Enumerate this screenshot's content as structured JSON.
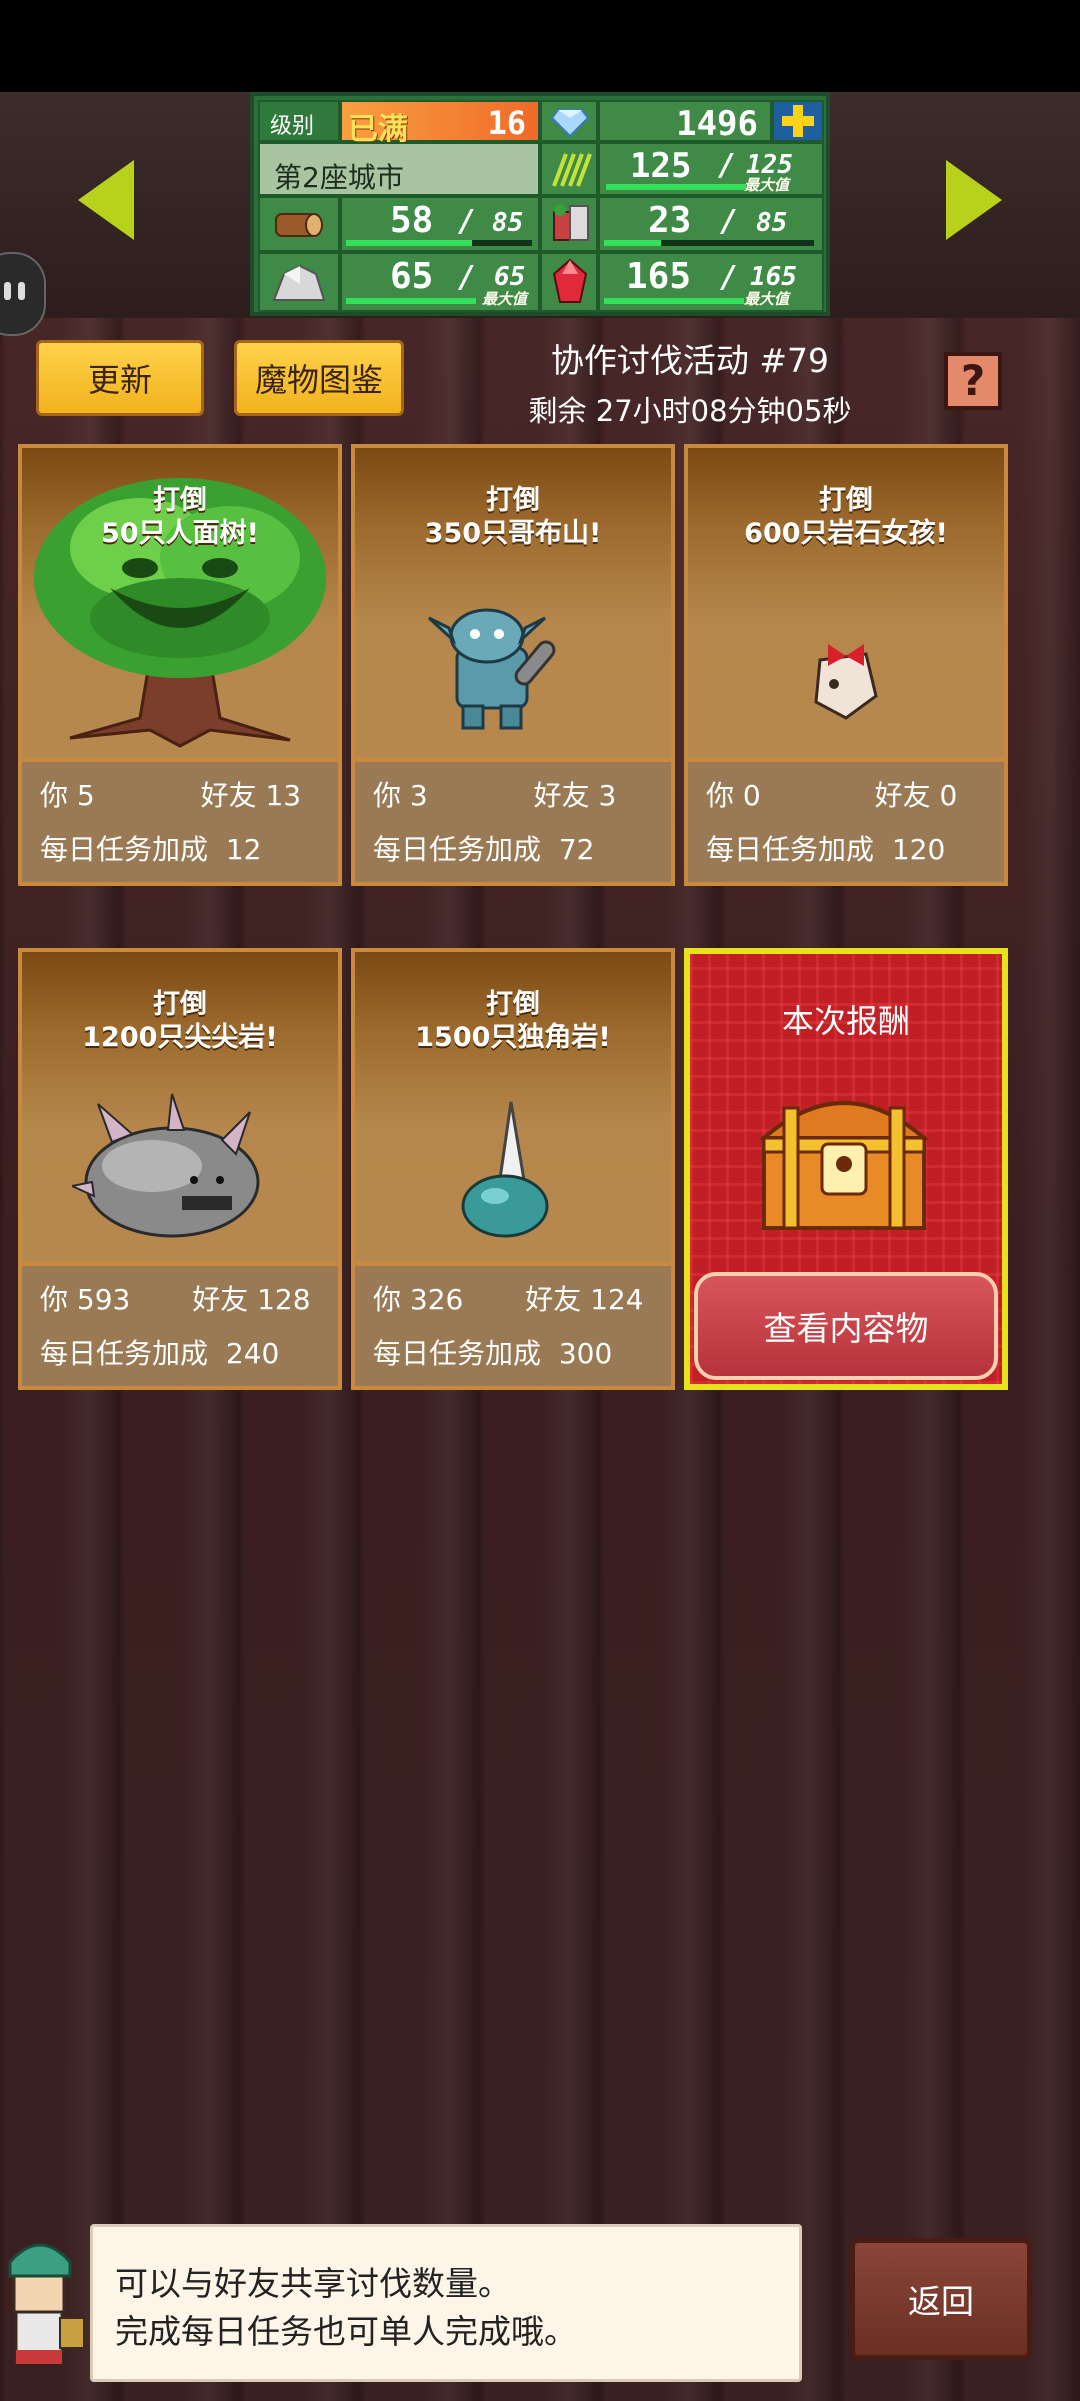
{
  "header": {
    "level_label": "级别",
    "level_max_label": "已满",
    "level_value": "16",
    "gems": "1496",
    "city_name": "第2座城市",
    "max_tag": "最大值",
    "resources": [
      {
        "name": "wood",
        "current": "58",
        "max": "85",
        "fill": 0.68
      },
      {
        "name": "grass",
        "current": "125",
        "max": "125",
        "fill": 1.0
      },
      {
        "name": "food",
        "current": "23",
        "max": "85",
        "fill": 0.27
      },
      {
        "name": "stone",
        "current": "65",
        "max": "65",
        "fill": 1.0
      },
      {
        "name": "ruby",
        "current": "165",
        "max": "165",
        "fill": 1.0
      }
    ],
    "separator": "/"
  },
  "toolbar": {
    "refresh_label": "更新",
    "bestiary_label": "魔物图鉴",
    "event_title": "协作讨伐活动 #79",
    "event_timer": "剩余 27小时08分钟05秒",
    "help_label": "?"
  },
  "cards": [
    {
      "title_line1": "打倒",
      "title_line2": "50只人面树!",
      "you_label": "你",
      "you": "5",
      "friend_label": "好友",
      "friend": "13",
      "bonus_label": "每日任务加成",
      "bonus": "12",
      "monster": "tree-monster-icon"
    },
    {
      "title_line1": "打倒",
      "title_line2": "350只哥布山!",
      "you_label": "你",
      "you": "3",
      "friend_label": "好友",
      "friend": "3",
      "bonus_label": "每日任务加成",
      "bonus": "72",
      "monster": "goblin-icon"
    },
    {
      "title_line1": "打倒",
      "title_line2": "600只岩石女孩!",
      "you_label": "你",
      "you": "0",
      "friend_label": "好友",
      "friend": "0",
      "bonus_label": "每日任务加成",
      "bonus": "120",
      "monster": "rock-girl-icon"
    },
    {
      "title_line1": "打倒",
      "title_line2": "1200只尖尖岩!",
      "you_label": "你",
      "you": "593",
      "friend_label": "好友",
      "friend": "128",
      "bonus_label": "每日任务加成",
      "bonus": "240",
      "monster": "spiky-rock-icon"
    },
    {
      "title_line1": "打倒",
      "title_line2": "1500只独角岩!",
      "you_label": "你",
      "you": "326",
      "friend_label": "好友",
      "friend": "124",
      "bonus_label": "每日任务加成",
      "bonus": "300",
      "monster": "horned-slime-icon"
    }
  ],
  "reward": {
    "title": "本次报酬",
    "button_label": "查看内容物"
  },
  "hint": {
    "line1": "可以与好友共享讨伐数量。",
    "line2": "完成每日任务也可单人完成哦。"
  },
  "back_label": "返回",
  "colors": {
    "accent_green": "#b8d21c",
    "button_yellow": "#ffd24a",
    "reward_red": "#c01f25"
  }
}
